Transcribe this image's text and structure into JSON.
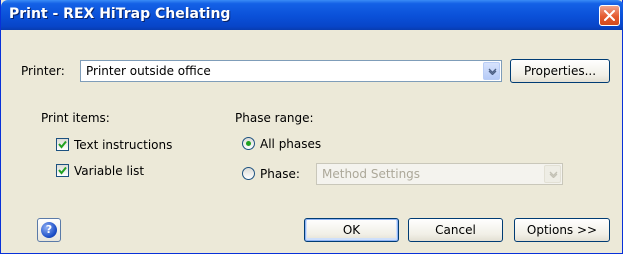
{
  "window": {
    "title": "Print - REX HiTrap Chelating"
  },
  "printer": {
    "label": "Printer:",
    "selected": "Printer outside office",
    "properties_label": "Properties..."
  },
  "print_items": {
    "label": "Print items:",
    "items": [
      {
        "label": "Text instructions",
        "checked": true
      },
      {
        "label": "Variable list",
        "checked": true
      }
    ]
  },
  "phase_range": {
    "label": "Phase range:",
    "options": [
      {
        "label": "All phases",
        "selected": true
      },
      {
        "label": "Phase:",
        "selected": false
      }
    ],
    "phase_select_value": "Method Settings"
  },
  "footer": {
    "ok_label": "OK",
    "cancel_label": "Cancel",
    "options_label": "Options >>"
  },
  "icons": {
    "close": "close-icon",
    "dropdown": "chevron-down-icon",
    "help": "help-icon"
  }
}
